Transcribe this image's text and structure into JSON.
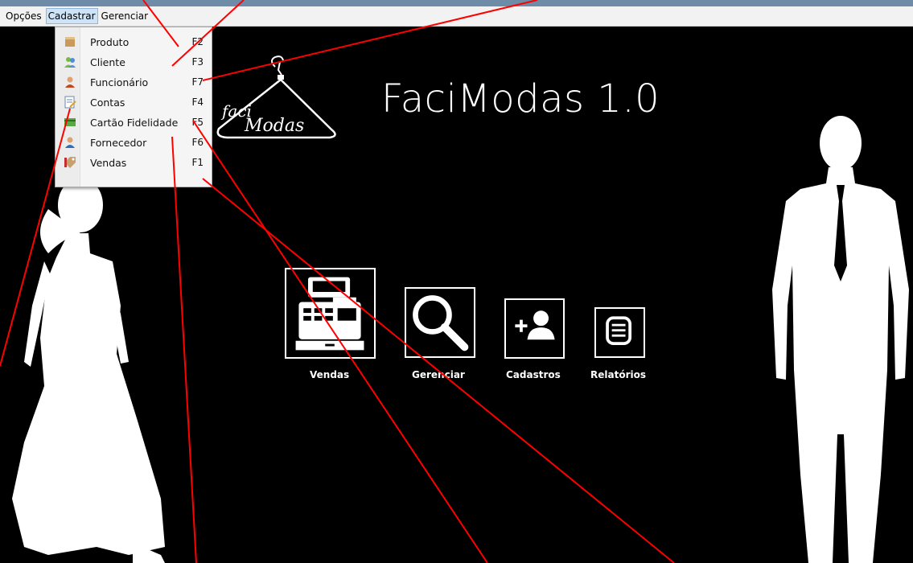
{
  "menubar": {
    "items": [
      "Opções",
      "Cadastrar",
      "Gerenciar"
    ]
  },
  "dropdown": {
    "items": [
      {
        "label": "Produto",
        "key": "F2",
        "icon": "box-icon"
      },
      {
        "label": "Cliente",
        "key": "F3",
        "icon": "users-icon"
      },
      {
        "label": "Funcionário",
        "key": "F7",
        "icon": "user-icon"
      },
      {
        "label": "Contas",
        "key": "F4",
        "icon": "ledger-icon"
      },
      {
        "label": "Cartão Fidelidade",
        "key": "F5",
        "icon": "card-icon"
      },
      {
        "label": "Fornecedor",
        "key": "F6",
        "icon": "supplier-icon"
      },
      {
        "label": "Vendas",
        "key": "F1",
        "icon": "tag-icon"
      }
    ]
  },
  "app": {
    "title": "FaciModas 1.0",
    "logo_text_1": "faci",
    "logo_text_2": "Modas"
  },
  "buttons": [
    {
      "label": "Vendas",
      "icon": "cash-register-icon"
    },
    {
      "label": "Gerenciar",
      "icon": "search-icon"
    },
    {
      "label": "Cadastros",
      "icon": "add-user-icon"
    },
    {
      "label": "Relatórios",
      "icon": "list-icon"
    }
  ],
  "colors": {
    "background": "#000000",
    "menubar": "#f2f2f2",
    "menu_active": "#cfe3f7",
    "annotation_line": "#ff0000"
  }
}
